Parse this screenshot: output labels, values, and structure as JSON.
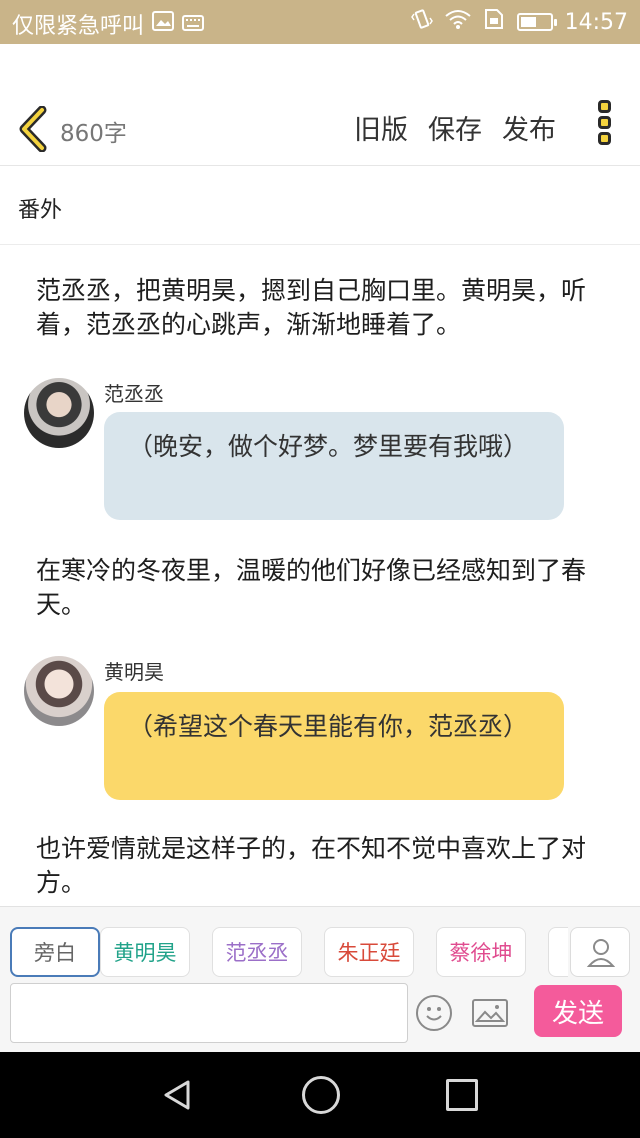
{
  "status_bar": {
    "app_label": "仅限紧急呼叫",
    "time": "14:57",
    "battery_level": 0.55,
    "icons": [
      "image-icon",
      "keyboard-icon",
      "vibrate-icon",
      "wifi-icon",
      "sim-icon",
      "battery-icon"
    ]
  },
  "header": {
    "word_count": "860字",
    "old_version_label": "旧版",
    "save_label": "保存",
    "publish_label": "发布"
  },
  "chapter_title": "番外",
  "content": {
    "para1": "范丞丞，把黄明昊，摁到自己胸口里。黄明昊，听着，范丞丞的心跳声，渐渐地睡着了。",
    "speaker1": "范丞丞",
    "bubble1": "（晚安，做个好梦。梦里要有我哦）",
    "para2": "在寒冷的冬夜里，温暖的他们好像已经感知到了春天。",
    "speaker2": "黄明昊",
    "bubble2": "（希望这个春天里能有你，范丞丞）",
    "para3": "也许爱情就是这样子的，在不知不觉中喜欢上了对方。"
  },
  "tabs": [
    {
      "label": "旁白",
      "color": "#666666"
    },
    {
      "label": "黄明昊",
      "color": "#22a38a"
    },
    {
      "label": "范丞丞",
      "color": "#9b6fc8"
    },
    {
      "label": "朱正廷",
      "color": "#d84a3a"
    },
    {
      "label": "蔡徐坤",
      "color": "#e04b8f"
    }
  ],
  "composer": {
    "input_value": "",
    "send_label": "发送"
  },
  "colors": {
    "status_bar": "#c9b489",
    "accent_yellow": "#f4d33e",
    "send_button": "#f45b9b",
    "bubble_blue": "#d9e5ec",
    "bubble_yellow": "#fbd86a"
  }
}
